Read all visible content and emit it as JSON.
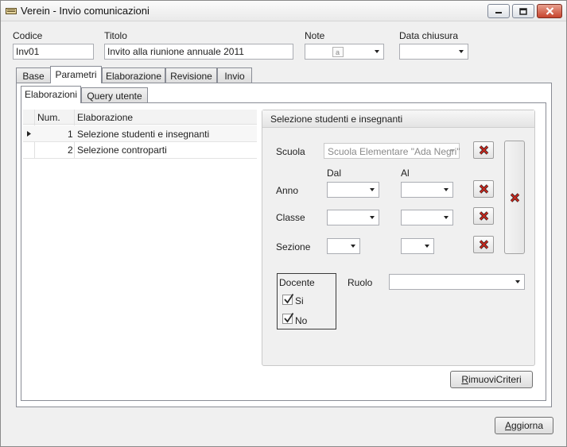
{
  "window": {
    "title": "Verein - Invio comunicazioni"
  },
  "header": {
    "codice_label": "Codice",
    "codice_value": "Inv01",
    "titolo_label": "Titolo",
    "titolo_value": "Invito alla riunione annuale 2011",
    "note_label": "Note",
    "data_chiusura_label": "Data chiusura"
  },
  "tabs": [
    {
      "label": "Base",
      "active": false
    },
    {
      "label": "Parametri",
      "active": true
    },
    {
      "label": "Elaborazione",
      "active": false
    },
    {
      "label": "Revisione",
      "active": false
    },
    {
      "label": "Invio",
      "active": false
    }
  ],
  "subtabs": [
    {
      "label": "Elaborazioni",
      "active": true
    },
    {
      "label": "Query utente",
      "active": false
    }
  ],
  "grid": {
    "columns": [
      "Num.",
      "Elaborazione"
    ],
    "rows": [
      {
        "num": "1",
        "name": "Selezione studenti e insegnanti",
        "current": true
      },
      {
        "num": "2",
        "name": "Selezione controparti",
        "current": false
      }
    ]
  },
  "criteria": {
    "title": "Selezione studenti e insegnanti",
    "scuola_label": "Scuola",
    "scuola_value": "Scuola Elementare \"Ada Negri\"",
    "dal_label": "Dal",
    "al_label": "Al",
    "anno_label": "Anno",
    "classe_label": "Classe",
    "sezione_label": "Sezione",
    "docente_label": "Docente",
    "si_label": "Si",
    "no_label": "No",
    "si_checked": true,
    "no_checked": true,
    "ruolo_label": "Ruolo"
  },
  "buttons": {
    "rimuovi_criteri_prefix": "R",
    "rimuovi_criteri_rest": "imuoviCriteri",
    "aggiorna_prefix": "A",
    "aggiorna_rest": "ggiorna"
  },
  "colors": {
    "delete_icon": "#c8281e",
    "window_bg": "#f0f0f0"
  },
  "icons": [
    "app-icon",
    "minimize-icon",
    "maximize-icon",
    "close-icon",
    "dropdown-arrow-icon",
    "delete-x-icon",
    "row-pointer-icon",
    "checkmark-icon",
    "note-icon"
  ]
}
